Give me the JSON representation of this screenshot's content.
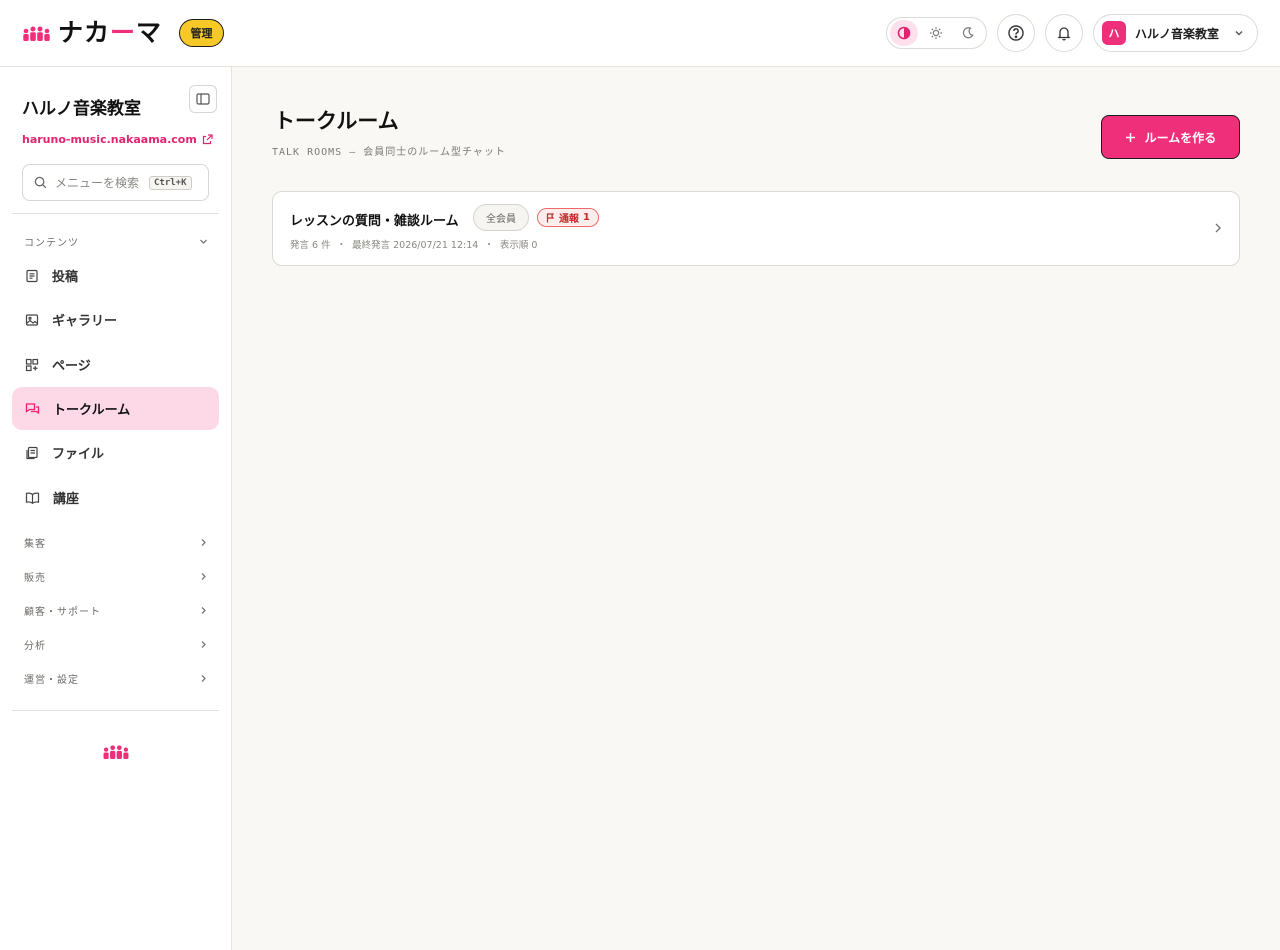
{
  "app": {
    "logo_text_a": "ナカ",
    "logo_text_dash": "ー",
    "logo_text_b": "マ",
    "admin_badge": "管理",
    "brand_color": "#ef2f7a"
  },
  "header": {
    "theme_options": [
      "contrast-icon",
      "sun-icon",
      "moon-icon"
    ],
    "theme_active": "contrast-icon",
    "account": {
      "avatar_letter": "ハ",
      "name": "ハルノ音楽教室"
    }
  },
  "sidebar": {
    "site_name": "ハルノ音楽教室",
    "site_url": "haruno-music.nakaama.com",
    "search_placeholder": "メニューを検索",
    "search_shortcut": "Ctrl+K",
    "content_section": "コンテンツ",
    "items": [
      {
        "label": "投稿",
        "icon": "document-icon"
      },
      {
        "label": "ギャラリー",
        "icon": "image-icon"
      },
      {
        "label": "ページ",
        "icon": "pages-icon"
      },
      {
        "label": "トークルーム",
        "icon": "chat-icon",
        "active": true
      },
      {
        "label": "ファイル",
        "icon": "files-icon"
      },
      {
        "label": "講座",
        "icon": "book-icon"
      }
    ],
    "sections": [
      "集客",
      "販売",
      "顧客・サポート",
      "分析",
      "運営・設定"
    ]
  },
  "main": {
    "title": "トークルーム",
    "subtitle": "TALK ROOMS — 会員同士のルーム型チャット",
    "create_button": "ルームを作る",
    "rooms": [
      {
        "name": "レッスンの質問・雑談ルーム",
        "audience": "全会員",
        "report_label": "通報",
        "report_count": "1",
        "posts": "発言 6 件",
        "last_post": "最終発言 2026/07/21 12:14",
        "order": "表示順 0"
      }
    ]
  }
}
